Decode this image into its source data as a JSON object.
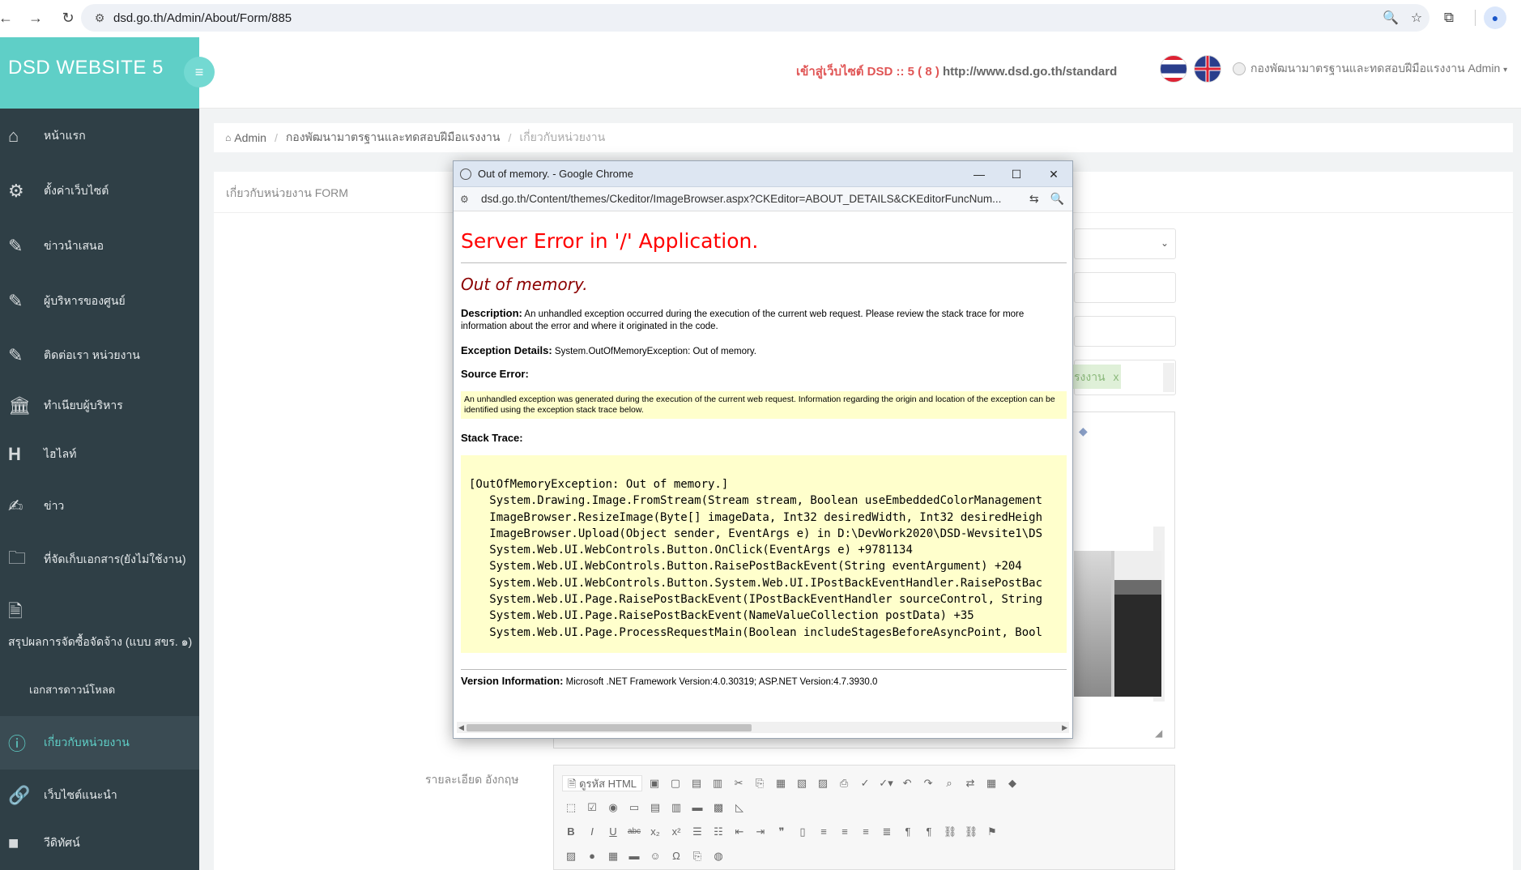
{
  "browser": {
    "url": "dsd.go.th/Admin/About/Form/885"
  },
  "sidebar": {
    "brand": "DSD WEBSITE 5",
    "items": [
      {
        "label": "หน้าแรก",
        "icon": "home-icon"
      },
      {
        "label": "ตั้งค่าเว็บไซต์",
        "icon": "gear-icon"
      },
      {
        "label": "ข่าวนำเสนอ",
        "icon": "pencil-icon"
      },
      {
        "label": "ผู้บริหารของศูนย์",
        "icon": "pencil-icon"
      },
      {
        "label": "ติดต่อเรา หน่วยงาน",
        "icon": "pencil-icon"
      },
      {
        "label": "ทำเนียบผู้บริหาร",
        "icon": "bank-icon"
      },
      {
        "label": "ไฮไลท์",
        "icon": "heading-icon"
      },
      {
        "label": "ข่าว",
        "icon": "edit-icon"
      },
      {
        "label": "ที่จัดเก็บเอกสาร(ยังไม่ใช้งาน)",
        "icon": "folder-icon"
      },
      {
        "label": "สรุปผลการจัดซื้อจัดจ้าง (แบบ สขร. ๑)",
        "icon": "document-icon"
      },
      {
        "label": "เอกสารดาวน์โหลด",
        "icon": ""
      },
      {
        "label": "เกี่ยวกับหน่วยงาน",
        "icon": "info-icon"
      },
      {
        "label": "เว็บไซต์แนะนำ",
        "icon": "link-icon"
      },
      {
        "label": "วีดิทัศน์",
        "icon": "video-icon"
      }
    ]
  },
  "header": {
    "headline": "เข้าสู่เว็บไซต์ DSD :: 5 ( 8 )",
    "headline_url": "http://www.dsd.go.th/standard",
    "user": "กองพัฒนามาตรฐานและทดสอบฝีมือแรงงาน Admin"
  },
  "breadcrumb": {
    "home": "Admin",
    "level1": "กองพัฒนามาตรฐานและทดสอบฝีมือแรงงาน",
    "level2": "เกี่ยวกับหน่วยงาน"
  },
  "panel": {
    "title": "เกี่ยวกับหน่วยงาน FORM",
    "tag_text": "รงงาน",
    "tag_close": "x",
    "label_en": "รายละเอียด อังกฤษ",
    "source_button": "ดูรหัส HTML"
  },
  "popup": {
    "window_title": "Out of memory. - Google Chrome",
    "url": "dsd.go.th/Content/themes/Ckeditor/ImageBrowser.aspx?CKEditor=ABOUT_DETAILS&CKEditorFuncNum...",
    "heading": "Server Error in '/' Application.",
    "subheading": "Out of memory.",
    "description_label": "Description:",
    "description": "An unhandled exception occurred during the execution of the current web request. Please review the stack trace for more information about the error and where it originated in the code.",
    "exception_label": "Exception Details:",
    "exception": "System.OutOfMemoryException: Out of memory.",
    "source_label": "Source Error:",
    "source_text": "An unhandled exception was generated during the execution of the current web request. Information regarding the origin and location of the exception can be identified using the exception stack trace below.",
    "stack_label": "Stack Trace:",
    "stack_lines": [
      "[OutOfMemoryException: Out of memory.]",
      "   System.Drawing.Image.FromStream(Stream stream, Boolean useEmbeddedColorManagement",
      "   ImageBrowser.ResizeImage(Byte[] imageData, Int32 desiredWidth, Int32 desiredHeigh",
      "   ImageBrowser.Upload(Object sender, EventArgs e) in D:\\DevWork2020\\DSD-Wevsite1\\DS",
      "   System.Web.UI.WebControls.Button.OnClick(EventArgs e) +9781134",
      "   System.Web.UI.WebControls.Button.RaisePostBackEvent(String eventArgument) +204",
      "   System.Web.UI.WebControls.Button.System.Web.UI.IPostBackEventHandler.RaisePostBac",
      "   System.Web.UI.Page.RaisePostBackEvent(IPostBackEventHandler sourceControl, String",
      "   System.Web.UI.Page.RaisePostBackEvent(NameValueCollection postData) +35",
      "   System.Web.UI.Page.ProcessRequestMain(Boolean includeStagesBeforeAsyncPoint, Bool"
    ],
    "version_label": "Version Information:",
    "version": "Microsoft .NET Framework Version:4.0.30319; ASP.NET Version:4.7.3930.0"
  }
}
